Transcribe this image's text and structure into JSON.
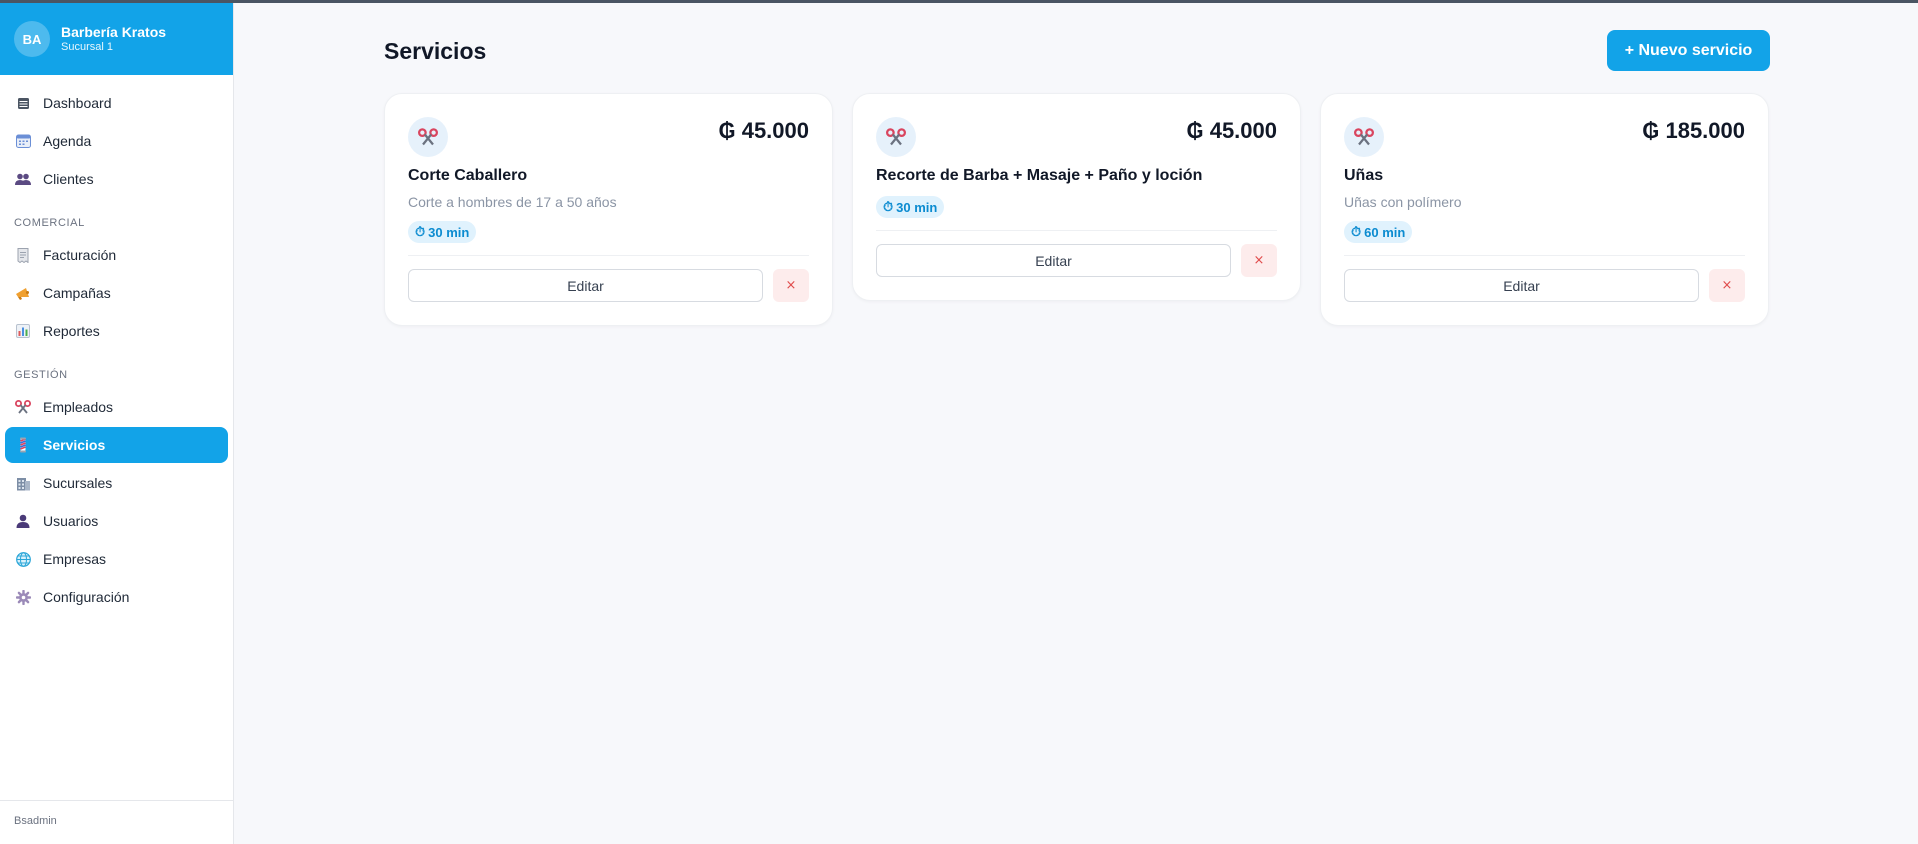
{
  "colors": {
    "accent": "#12a3e8",
    "danger": "#e04b4b",
    "badge_bg": "#e0f2fd"
  },
  "brand": {
    "initials": "BA",
    "name": "Barbería Kratos",
    "branch": "Sucursal 1"
  },
  "nav": {
    "items": [
      {
        "label": "Dashboard",
        "icon": "dashboard-icon"
      },
      {
        "label": "Agenda",
        "icon": "calendar-icon"
      },
      {
        "label": "Clientes",
        "icon": "people-icon"
      }
    ],
    "comercial_label": "COMERCIAL",
    "comercial": [
      {
        "label": "Facturación",
        "icon": "receipt-icon"
      },
      {
        "label": "Campañas",
        "icon": "megaphone-icon"
      },
      {
        "label": "Reportes",
        "icon": "bar-chart-icon"
      }
    ],
    "gestion_label": "GESTIÓN",
    "gestion": [
      {
        "label": "Empleados",
        "icon": "scissors-icon"
      },
      {
        "label": "Servicios",
        "icon": "barber-pole-icon",
        "active": true
      },
      {
        "label": "Sucursales",
        "icon": "building-icon"
      },
      {
        "label": "Usuarios",
        "icon": "user-icon"
      },
      {
        "label": "Empresas",
        "icon": "globe-icon"
      },
      {
        "label": "Configuración",
        "icon": "gear-icon"
      }
    ]
  },
  "footer": {
    "user": "Bsadmin"
  },
  "page": {
    "title": "Servicios",
    "new_button": "+ Nuevo servicio"
  },
  "services": [
    {
      "name": "Corte Caballero",
      "price": "₲ 45.000",
      "description": "Corte a hombres de 17 a 50 años",
      "duration": "30 min",
      "edit": "Editar",
      "delete": "×"
    },
    {
      "name": "Recorte de Barba + Masaje + Paño y loción",
      "price": "₲ 45.000",
      "description": "",
      "duration": "30 min",
      "edit": "Editar",
      "delete": "×"
    },
    {
      "name": "Uñas",
      "price": "₲ 185.000",
      "description": "Uñas con polímero",
      "duration": "60 min",
      "edit": "Editar",
      "delete": "×"
    }
  ],
  "duration_icon": "⏱"
}
